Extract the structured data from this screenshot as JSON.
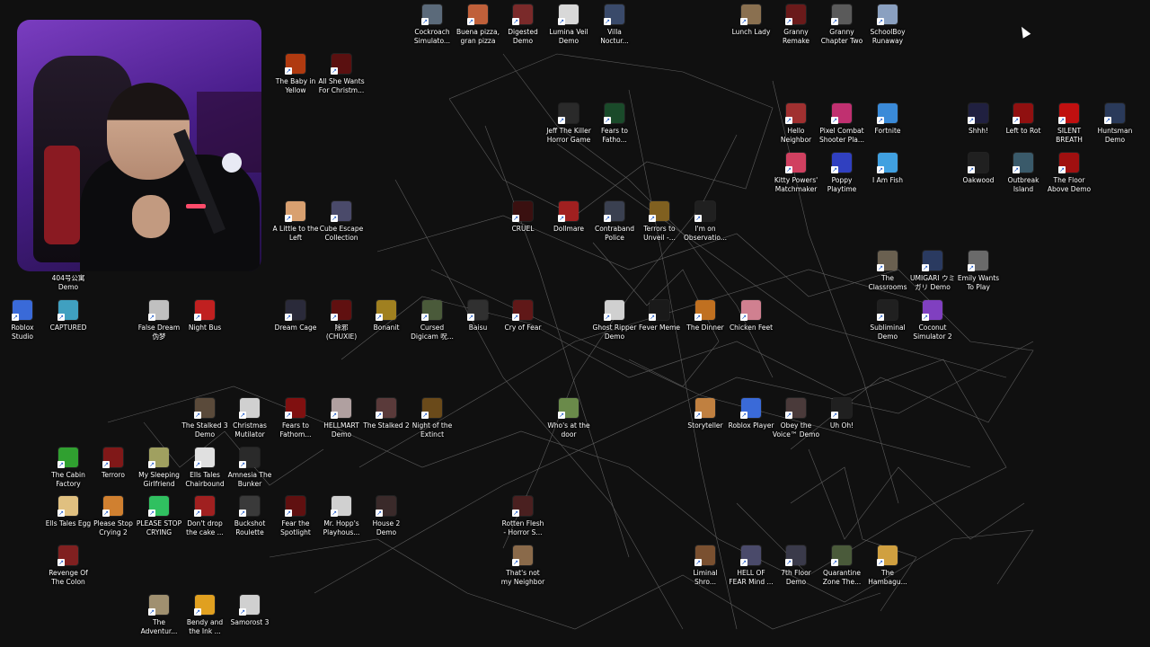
{
  "colors": {
    "background": "#101010",
    "wallpaper_lines": "#9a9a9a",
    "label_text": "#ffffff",
    "webcam_accent": "#7a3dc0"
  },
  "desktop": {
    "icons": [
      {
        "label": "Cockroach\nSimulato...",
        "color": "#5b6a7a"
      },
      {
        "label": "Buena pizza,\ngran pizza",
        "color": "#c0603a"
      },
      {
        "label": "Digested\nDemo",
        "color": "#7a2a2a"
      },
      {
        "label": "Lumina Veil\nDemo",
        "color": "#d8d8d8"
      },
      {
        "label": "Villa\nNoctur...",
        "color": "#3a4a6a"
      },
      {
        "label": "Lunch Lady",
        "color": "#8a7050"
      },
      {
        "label": "Granny\nRemake",
        "color": "#6a1a1a"
      },
      {
        "label": "Granny\nChapter Two",
        "color": "#5a5a5a"
      },
      {
        "label": "SchoolBoy\nRunaway",
        "color": "#8aa0c0"
      },
      {
        "label": "The Baby in\nYellow",
        "color": "#b03a10"
      },
      {
        "label": "All She Wants\nFor Christm...",
        "color": "#5a1010"
      },
      {
        "label": "Jeff The Killer\nHorror Game",
        "color": "#2a2a2a"
      },
      {
        "label": "Fears to\nFatho...",
        "color": "#1a4a2a"
      },
      {
        "label": "Hello\nNeighbor",
        "color": "#a03030"
      },
      {
        "label": "Pixel Combat\nShooter Pla...",
        "color": "#c03070"
      },
      {
        "label": "Fortnite",
        "color": "#3a8ad8"
      },
      {
        "label": "Shhh!",
        "color": "#202040"
      },
      {
        "label": "Left to Rot",
        "color": "#901010"
      },
      {
        "label": "SILENT\nBREATH",
        "color": "#c01010"
      },
      {
        "label": "Huntsman\nDemo",
        "color": "#2a3a5a"
      },
      {
        "label": "Kitty Powers'\nMatchmaker",
        "color": "#d04060"
      },
      {
        "label": "Poppy\nPlaytime",
        "color": "#3040c0"
      },
      {
        "label": "I Am Fish",
        "color": "#40a0e0"
      },
      {
        "label": "Oakwood",
        "color": "#202020"
      },
      {
        "label": "Outbreak\nIsland",
        "color": "#3a5a6a"
      },
      {
        "label": "The Floor\nAbove Demo",
        "color": "#a01010"
      },
      {
        "label": "A Little to the\nLeft",
        "color": "#d8a070"
      },
      {
        "label": "Cube Escape\nCollection",
        "color": "#4a4a6a"
      },
      {
        "label": "CRUEL",
        "color": "#3a1010"
      },
      {
        "label": "Dollmare",
        "color": "#a02020"
      },
      {
        "label": "Contraband\nPolice",
        "color": "#3a4050"
      },
      {
        "label": "Terrors to\nUnveil -...",
        "color": "#806020"
      },
      {
        "label": "I'm on\nObservatio...",
        "color": "#202020"
      },
      {
        "label": "404号公寓\nDemo",
        "color": "#3a3a3a"
      },
      {
        "label": "The\nClassrooms",
        "color": "#6a6050"
      },
      {
        "label": "UMIGARI ウミ\nガリ Demo",
        "color": "#2a3a60"
      },
      {
        "label": "Emily Wants\nTo Play",
        "color": "#6a6a6a"
      },
      {
        "label": "Roblox\nStudio",
        "color": "#3a6ad8"
      },
      {
        "label": "CAPTURED",
        "color": "#40a0c0"
      },
      {
        "label": "False Dream\n伪梦",
        "color": "#c0c0c0"
      },
      {
        "label": "Night Bus",
        "color": "#c02020"
      },
      {
        "label": "Dream Cage",
        "color": "#2a2a3a"
      },
      {
        "label": "除邪\n(CHUXIE)",
        "color": "#601010"
      },
      {
        "label": "Bonanit",
        "color": "#a08020"
      },
      {
        "label": "Cursed\nDigicam 呪...",
        "color": "#4a5a3a"
      },
      {
        "label": "Baisu",
        "color": "#303030"
      },
      {
        "label": "Cry of Fear",
        "color": "#601818"
      },
      {
        "label": "Ghost Ripper\nDemo",
        "color": "#d0d0d0"
      },
      {
        "label": "Fever Meme",
        "color": "#1a1a1a"
      },
      {
        "label": "The Dinner",
        "color": "#c07020"
      },
      {
        "label": "Chicken Feet",
        "color": "#d08090"
      },
      {
        "label": "Subliminal\nDemo",
        "color": "#202020"
      },
      {
        "label": "Coconut\nSimulator 2",
        "color": "#8040c0"
      },
      {
        "label": "The Stalked 3\nDemo",
        "color": "#5a4a3a"
      },
      {
        "label": "Christmas\nMutilator",
        "color": "#d0d0d0"
      },
      {
        "label": "Fears to\nFathom...",
        "color": "#801010"
      },
      {
        "label": "HELLMART\nDemo",
        "color": "#b0a0a0"
      },
      {
        "label": "The Stalked 2",
        "color": "#5a3a3a"
      },
      {
        "label": "Night of the\nExtinct",
        "color": "#6a4a1a"
      },
      {
        "label": "Who's at the\ndoor",
        "color": "#6a8a4a"
      },
      {
        "label": "Storyteller",
        "color": "#c08040"
      },
      {
        "label": "Roblox Player",
        "color": "#3a6ad8"
      },
      {
        "label": "Obey the\nVoice™ Demo",
        "color": "#4a3a3a"
      },
      {
        "label": "Uh Oh!",
        "color": "#202020"
      },
      {
        "label": "The Cabin\nFactory",
        "color": "#30a030"
      },
      {
        "label": "Terroro",
        "color": "#801818"
      },
      {
        "label": "My Sleeping\nGirlfriend",
        "color": "#a0a060"
      },
      {
        "label": "Ells Tales\nChairbound",
        "color": "#e0e0e0"
      },
      {
        "label": "Amnesia The\nBunker",
        "color": "#2a2a2a"
      },
      {
        "label": "Ells Tales Egg",
        "color": "#e0c080"
      },
      {
        "label": "Please Stop\nCrying 2",
        "color": "#d08030"
      },
      {
        "label": "PLEASE STOP\nCRYING",
        "color": "#30c060"
      },
      {
        "label": "Don't drop\nthe cake ...",
        "color": "#a02020"
      },
      {
        "label": "Buckshot\nRoulette",
        "color": "#3a3a3a"
      },
      {
        "label": "Fear the\nSpotlight",
        "color": "#601010"
      },
      {
        "label": "Mr. Hopp's\nPlayhous...",
        "color": "#d0d0d0"
      },
      {
        "label": "House 2\nDemo",
        "color": "#3a2a2a"
      },
      {
        "label": "Rotten Flesh\n- Horror S...",
        "color": "#4a2020"
      },
      {
        "label": "Revenge Of\nThe Colon",
        "color": "#802020"
      },
      {
        "label": "That's not\nmy Neighbor",
        "color": "#8a6a4a"
      },
      {
        "label": "Liminal\nShro...",
        "color": "#7a5030"
      },
      {
        "label": "HELL OF\nFEAR Mind ...",
        "color": "#4a4a6a"
      },
      {
        "label": "7th Floor\nDemo",
        "color": "#3a3a4a"
      },
      {
        "label": "Quarantine\nZone The...",
        "color": "#4a5a3a"
      },
      {
        "label": "The\nHambagu...",
        "color": "#d0a040"
      },
      {
        "label": "The\nAdventur...",
        "color": "#a09070"
      },
      {
        "label": "Bendy and\nthe Ink ...",
        "color": "#e0a020"
      },
      {
        "label": "Samorost 3",
        "color": "#d0d0d0"
      }
    ]
  }
}
